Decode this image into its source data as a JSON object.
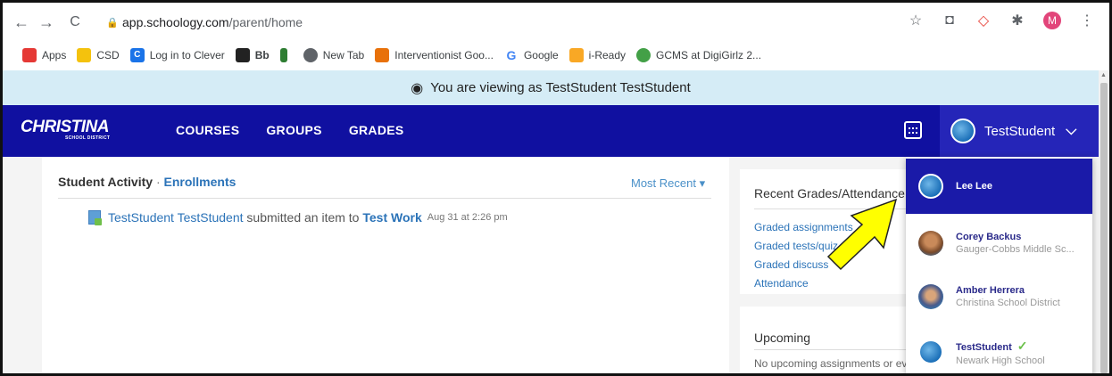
{
  "browser": {
    "url_host": "app.schoology.com",
    "url_path": "/parent/home",
    "profile_initial": "M",
    "bookmarks": [
      {
        "label": "Apps",
        "icon": "apps-grid-icon",
        "color": "#e53935"
      },
      {
        "label": "CSD",
        "icon": "folder-icon",
        "color": "#f4c20d"
      },
      {
        "label": "Log in to Clever",
        "icon": "clever-icon",
        "color": "#1a73e8"
      },
      {
        "label": "Bb",
        "icon": "blackboard-icon",
        "color": "#222222"
      },
      {
        "label": "",
        "icon": "tree-icon",
        "color": "#2e7d32"
      },
      {
        "label": "New Tab",
        "icon": "globe-icon",
        "color": "#5f6368"
      },
      {
        "label": "Interventionist Goo...",
        "icon": "dsc-icon",
        "color": "#e8710a"
      },
      {
        "label": "Google",
        "icon": "google-icon",
        "color": "#4285f4"
      },
      {
        "label": "i-Ready",
        "icon": "iready-icon",
        "color": "#f9a825"
      },
      {
        "label": "GCMS at DigiGirlz 2...",
        "icon": "pinwheel-icon",
        "color": "#43a047"
      }
    ]
  },
  "banner": {
    "text": "You are viewing as TestStudent TestStudent"
  },
  "header": {
    "logo_main": "CHRISTINA",
    "logo_sub": "SCHOOL DISTRICT",
    "nav": [
      "COURSES",
      "GROUPS",
      "GRADES"
    ],
    "user_name": "TestStudent"
  },
  "activity": {
    "title": "Student Activity",
    "separator": "·",
    "enrollments": "Enrollments",
    "sort": "Most Recent ▾",
    "item": {
      "actor": "TestStudent TestStudent",
      "action": " submitted an item to ",
      "target": "Test Work",
      "date": "Aug 31 at 2:26 pm"
    }
  },
  "grades_card": {
    "title": "Recent Grades/Attendance",
    "links": [
      "Graded assignments",
      "Graded tests/quiz",
      "Graded discuss",
      "Attendance"
    ]
  },
  "upcoming": {
    "title": "Upcoming",
    "text": "No upcoming assignments or ev"
  },
  "dropdown": [
    {
      "name": "Lee Lee",
      "sub": "",
      "avatar": "av-blue",
      "active": true,
      "checked": false
    },
    {
      "name": "Corey Backus",
      "sub": "Gauger-Cobbs Middle Sc...",
      "avatar": "av-photo1",
      "active": false,
      "checked": false
    },
    {
      "name": "Amber Herrera",
      "sub": "Christina School District",
      "avatar": "av-photo2",
      "active": false,
      "checked": false
    },
    {
      "name": "TestStudent",
      "sub": "Newark High School",
      "avatar": "av-blue",
      "active": false,
      "checked": true
    }
  ],
  "colors": {
    "header": "#1010a0",
    "banner": "#d5ecf6",
    "arrow": "#ffff00",
    "link": "#2b73b8"
  }
}
